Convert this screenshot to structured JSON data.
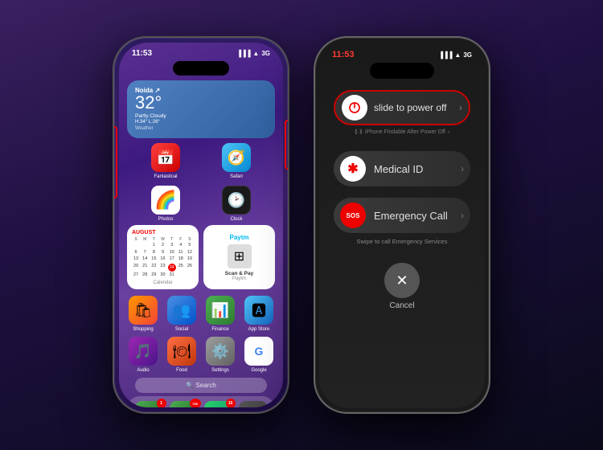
{
  "phone1": {
    "status": {
      "time": "11:53",
      "signal": "all  ",
      "wifi": "WiFi",
      "network": "3G"
    },
    "weather": {
      "city": "Noida ↗",
      "temp": "32°",
      "description": "Partly Cloudy",
      "hi": "H:34°",
      "lo": "L:26°",
      "label": "Weather"
    },
    "apps_row1": [
      {
        "name": "Fantastical",
        "emoji": "📅",
        "class": "fantastical"
      },
      {
        "name": "Safari",
        "emoji": "🧭",
        "class": "safari"
      }
    ],
    "apps_row2": [
      {
        "name": "Photos",
        "emoji": "🖼",
        "class": "photos"
      },
      {
        "name": "Clock",
        "emoji": "🕐",
        "class": "clock"
      }
    ],
    "calendar": {
      "month": "AUGUST",
      "days_header": [
        "S",
        "M",
        "T",
        "W",
        "T",
        "F",
        "S"
      ],
      "label": "Calendar"
    },
    "paytm": {
      "logo": "Paytm",
      "scan_label": "Scan & Pay",
      "label": "Paytm"
    },
    "apps_bottom1": [
      {
        "name": "Shopping",
        "emoji": "🛍",
        "class": "shopping",
        "badge": ""
      },
      {
        "name": "Social",
        "emoji": "💬",
        "class": "social",
        "badge": ""
      },
      {
        "name": "Finance",
        "emoji": "💹",
        "class": "finance",
        "badge": ""
      },
      {
        "name": "App Store",
        "emoji": "🅰",
        "class": "appstore",
        "badge": ""
      }
    ],
    "apps_bottom2": [
      {
        "name": "Audio",
        "emoji": "🎵",
        "class": "audio",
        "badge": ""
      },
      {
        "name": "Food",
        "emoji": "🍽",
        "class": "food",
        "badge": ""
      },
      {
        "name": "Settings",
        "emoji": "⚙️",
        "class": "settings",
        "badge": ""
      },
      {
        "name": "Google",
        "emoji": "G",
        "class": "google",
        "badge": ""
      }
    ],
    "search": "Search",
    "dock": [
      {
        "name": "Phone",
        "emoji": "📞",
        "class": "phone-app",
        "badge": "1"
      },
      {
        "name": "Messages",
        "emoji": "💬",
        "class": "messages-app",
        "badge": "755"
      },
      {
        "name": "WhatsApp",
        "emoji": "💬",
        "class": "whatsapp-app",
        "badge": "10"
      },
      {
        "name": "Camera",
        "emoji": "📷",
        "class": "camera-app",
        "badge": ""
      }
    ]
  },
  "phone2": {
    "status": {
      "time": "11:53",
      "signal": "all",
      "wifi": "WiFi",
      "network": "3G"
    },
    "power_slider": {
      "text": "slide to power off",
      "findable": "iPhone Findable After Power Off"
    },
    "medical_id": {
      "label": "Medical ID"
    },
    "sos": {
      "button_text": "SOS",
      "label": "Emergency Call",
      "full_label": "SOS Emergency Call",
      "swipe_text": "Swipe to call Emergency Services"
    },
    "cancel": {
      "label": "Cancel"
    }
  }
}
